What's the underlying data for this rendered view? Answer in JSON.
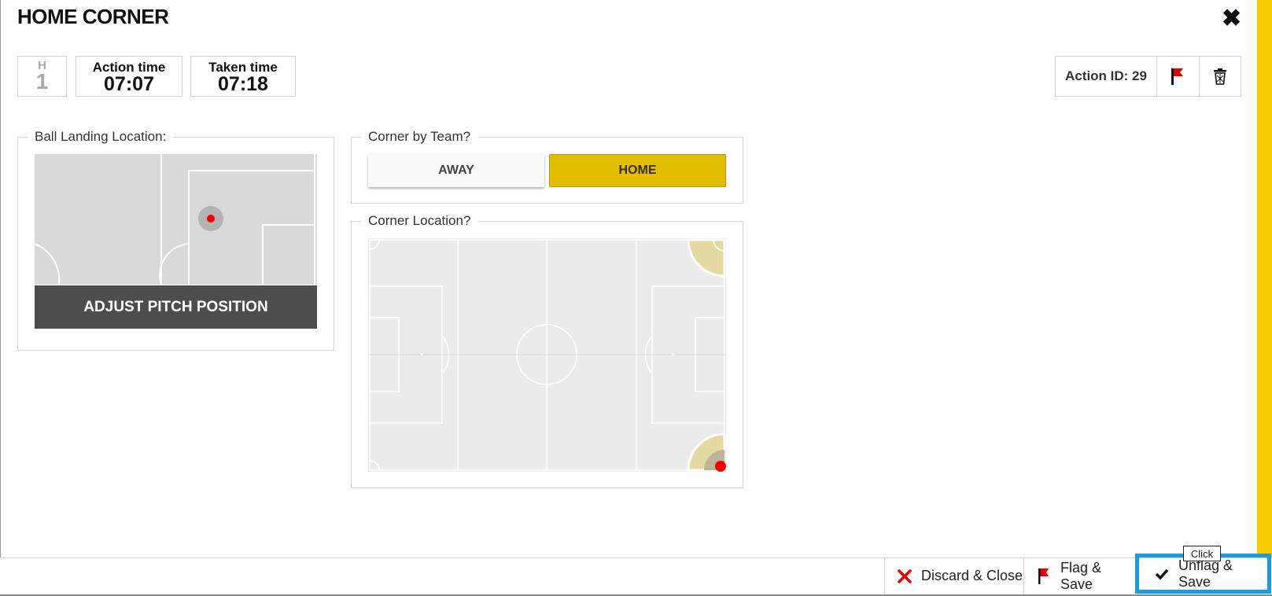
{
  "header": {
    "title": "HOME CORNER",
    "close_icon": "close-icon"
  },
  "timing": {
    "half_label": "H",
    "half_value": "1",
    "action_time_label": "Action time",
    "action_time_value": "07:07",
    "taken_time_label": "Taken time",
    "taken_time_value": "07:18"
  },
  "action_bar": {
    "action_id_label": "Action ID: 29",
    "flag_icon": "flag-icon",
    "delete_icon": "trash-icon"
  },
  "ball_landing": {
    "legend": "Ball Landing Location:",
    "adjust_label": "ADJUST PITCH POSITION"
  },
  "corner_team": {
    "legend": "Corner by Team?",
    "away_label": "AWAY",
    "home_label": "HOME",
    "selected": "HOME",
    "selected_color": "#e2bd00"
  },
  "corner_location": {
    "legend": "Corner Location?"
  },
  "footer": {
    "discard_label": "Discard & Close",
    "flag_save_label": "Flag & Save",
    "unflag_save_label": "Unflag & Save",
    "tooltip": "Click"
  },
  "colors": {
    "accent_yellow": "#f7cb00",
    "highlight_blue": "#1a9be0",
    "marker_red": "#ee0000"
  }
}
